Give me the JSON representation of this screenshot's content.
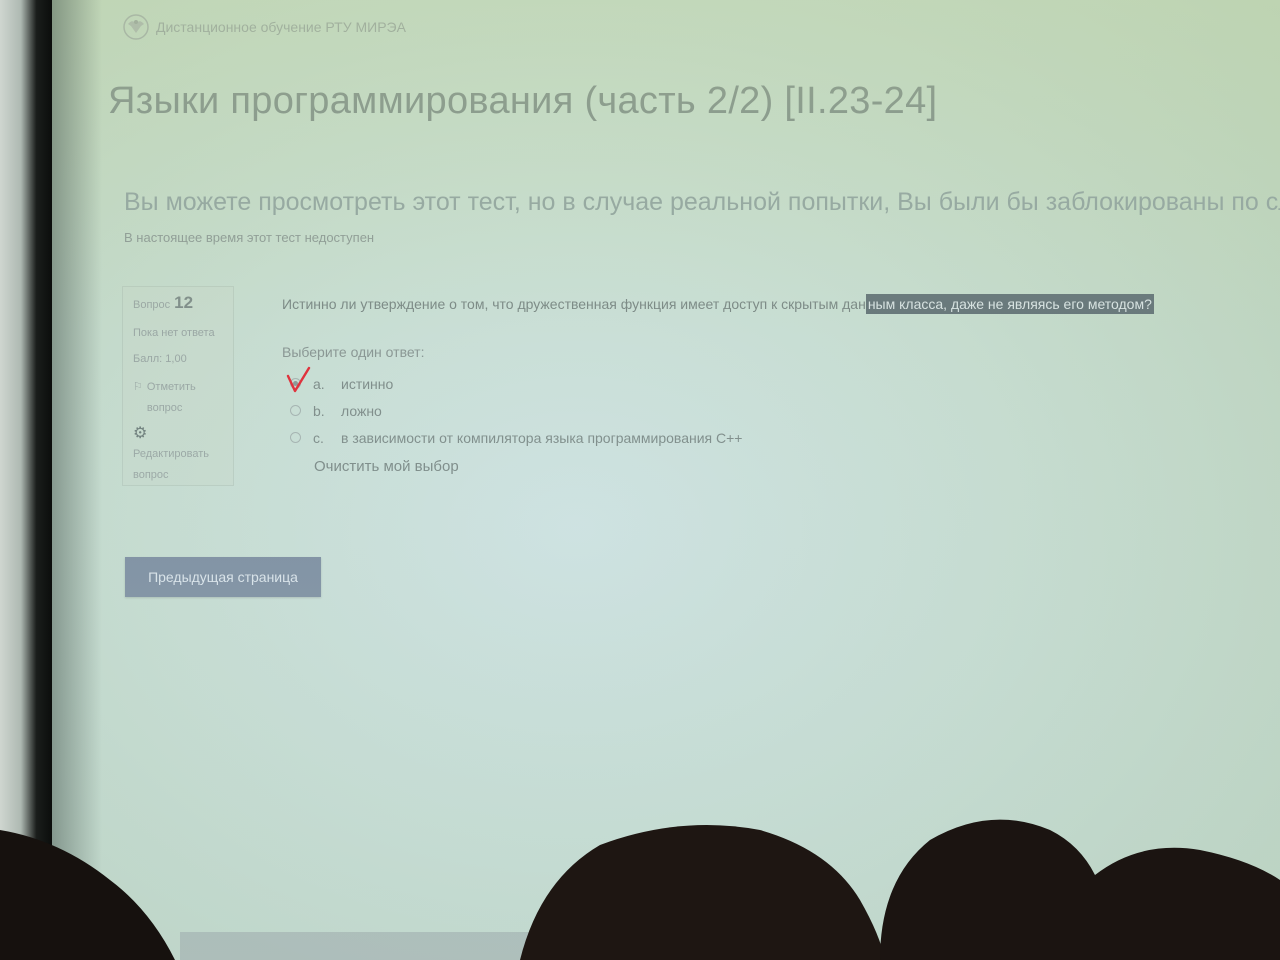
{
  "site": {
    "name": "Дистанционное обучение РТУ МИРЭА",
    "logo_icon": "eagle-emblem-icon"
  },
  "course_title": "Языки программирования (часть 2/2) [II.23-24]",
  "notice": {
    "main": "Вы можете просмотреть этот тест, но в случае реальной попытки, Вы были бы заблокированы по сле",
    "sub": "В настоящее время этот тест недоступен"
  },
  "question_info": {
    "label": "Вопрос",
    "number": "12",
    "status": "Пока нет ответа",
    "score": "Балл: 1,00",
    "flag_label": "Отметить вопрос",
    "flag_icon": "flag-icon",
    "edit_label": "Редактировать вопрос",
    "edit_icon": "gear-icon"
  },
  "question": {
    "text_plain": "Истинно ли утверждение о том, что дружественная функция имеет доступ к скрытым дан",
    "text_highlighted": "ным класса, даже не являясь его методом?",
    "prompt": "Выберите один ответ:",
    "options": [
      {
        "letter": "a.",
        "text": "истинно",
        "selected": true
      },
      {
        "letter": "b.",
        "text": "ложно",
        "selected": false
      },
      {
        "letter": "c.",
        "text": "в зависимости от компилятора языка программирования C++",
        "selected": false
      }
    ],
    "clear_label": "Очистить мой выбор"
  },
  "navigation": {
    "prev_label": "Предыдущая страница"
  },
  "colors": {
    "screen_bg": "#c6dccf",
    "button_bg": "#7d8ea0",
    "highlight_bg": "#67777b",
    "checkmark": "#e0303a"
  }
}
